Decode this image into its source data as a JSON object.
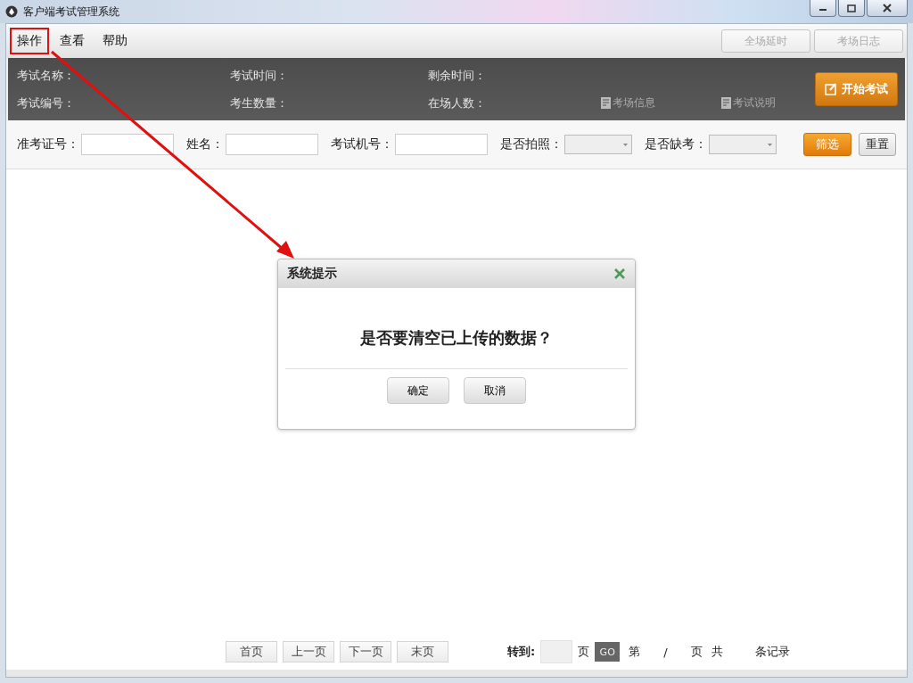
{
  "window": {
    "title": "客户端考试管理系统"
  },
  "menu": [
    {
      "label": "操作",
      "annotated": true
    },
    {
      "label": "查看",
      "annotated": false
    },
    {
      "label": "帮助",
      "annotated": false
    }
  ],
  "toolbar_buttons": [
    {
      "label": "全场延时",
      "disabled": true
    },
    {
      "label": "考场日志",
      "disabled": true
    }
  ],
  "info_panel": {
    "rows": [
      [
        "考试名称：",
        "考试时间：",
        "剩余时间："
      ],
      [
        "考试编号：",
        "考生数量：",
        "在场人数："
      ]
    ],
    "links": [
      "考场信息",
      "考试说明"
    ],
    "start_button": "开始考试"
  },
  "filters": [
    {
      "kind": "text",
      "label": "准考证号："
    },
    {
      "kind": "text",
      "label": "姓名："
    },
    {
      "kind": "text",
      "label": "考试机号："
    },
    {
      "kind": "select",
      "label": "是否拍照："
    },
    {
      "kind": "select",
      "label": "是否缺考："
    }
  ],
  "filter_buttons": [
    {
      "label": "筛选",
      "kind": "primary"
    },
    {
      "label": "重置",
      "kind": "secondary"
    }
  ],
  "pager": {
    "nav_buttons": [
      "首页",
      "上一页",
      "下一页",
      "末页"
    ],
    "goto_label": "转到:",
    "page_unit": "页",
    "go_button": "GO",
    "status": [
      "第",
      "/",
      "页",
      "共",
      "条记录"
    ]
  },
  "dialog": {
    "title": "系统提示",
    "message": "是否要清空已上传的数据？",
    "buttons": [
      "确定",
      "取消"
    ]
  }
}
